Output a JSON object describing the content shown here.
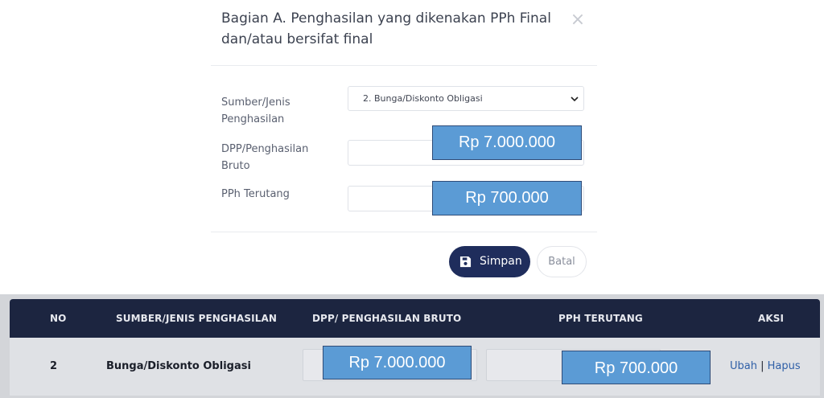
{
  "modal": {
    "title": "Bagian A. Penghasilan yang dikenakan PPh Final dan/atau bersifat final",
    "close_glyph": "×",
    "fields": {
      "source_label": "Sumber/Jenis Penghasilan",
      "source_value": "2. Bunga/Diskonto Obligasi",
      "dpp_label": "DPP/Penghasilan Bruto",
      "dpp_value": "Rp 7.000.000",
      "pph_label": "PPh Terutang",
      "pph_value": "Rp 700.000"
    },
    "buttons": {
      "save_label": "Simpan",
      "cancel_label": "Batal"
    }
  },
  "table": {
    "headers": {
      "no": "NO",
      "source": "SUMBER/JENIS PENGHASILAN",
      "dpp": "DPP/ PENGHASILAN BRUTO",
      "pph": "PPH TERUTANG",
      "actions": "AKSI"
    },
    "rows": [
      {
        "no": "2",
        "source": "Bunga/Diskonto Obligasi",
        "dpp": "Rp 7.000.000",
        "pph": "Rp 700.000",
        "edit_label": "Ubah",
        "separator": "|",
        "delete_label": "Hapus"
      }
    ]
  },
  "colors": {
    "primary": "#1f2d5c",
    "table_header": "#1c2540",
    "highlight": "#5b9bd5",
    "link": "#2f5fa7"
  }
}
